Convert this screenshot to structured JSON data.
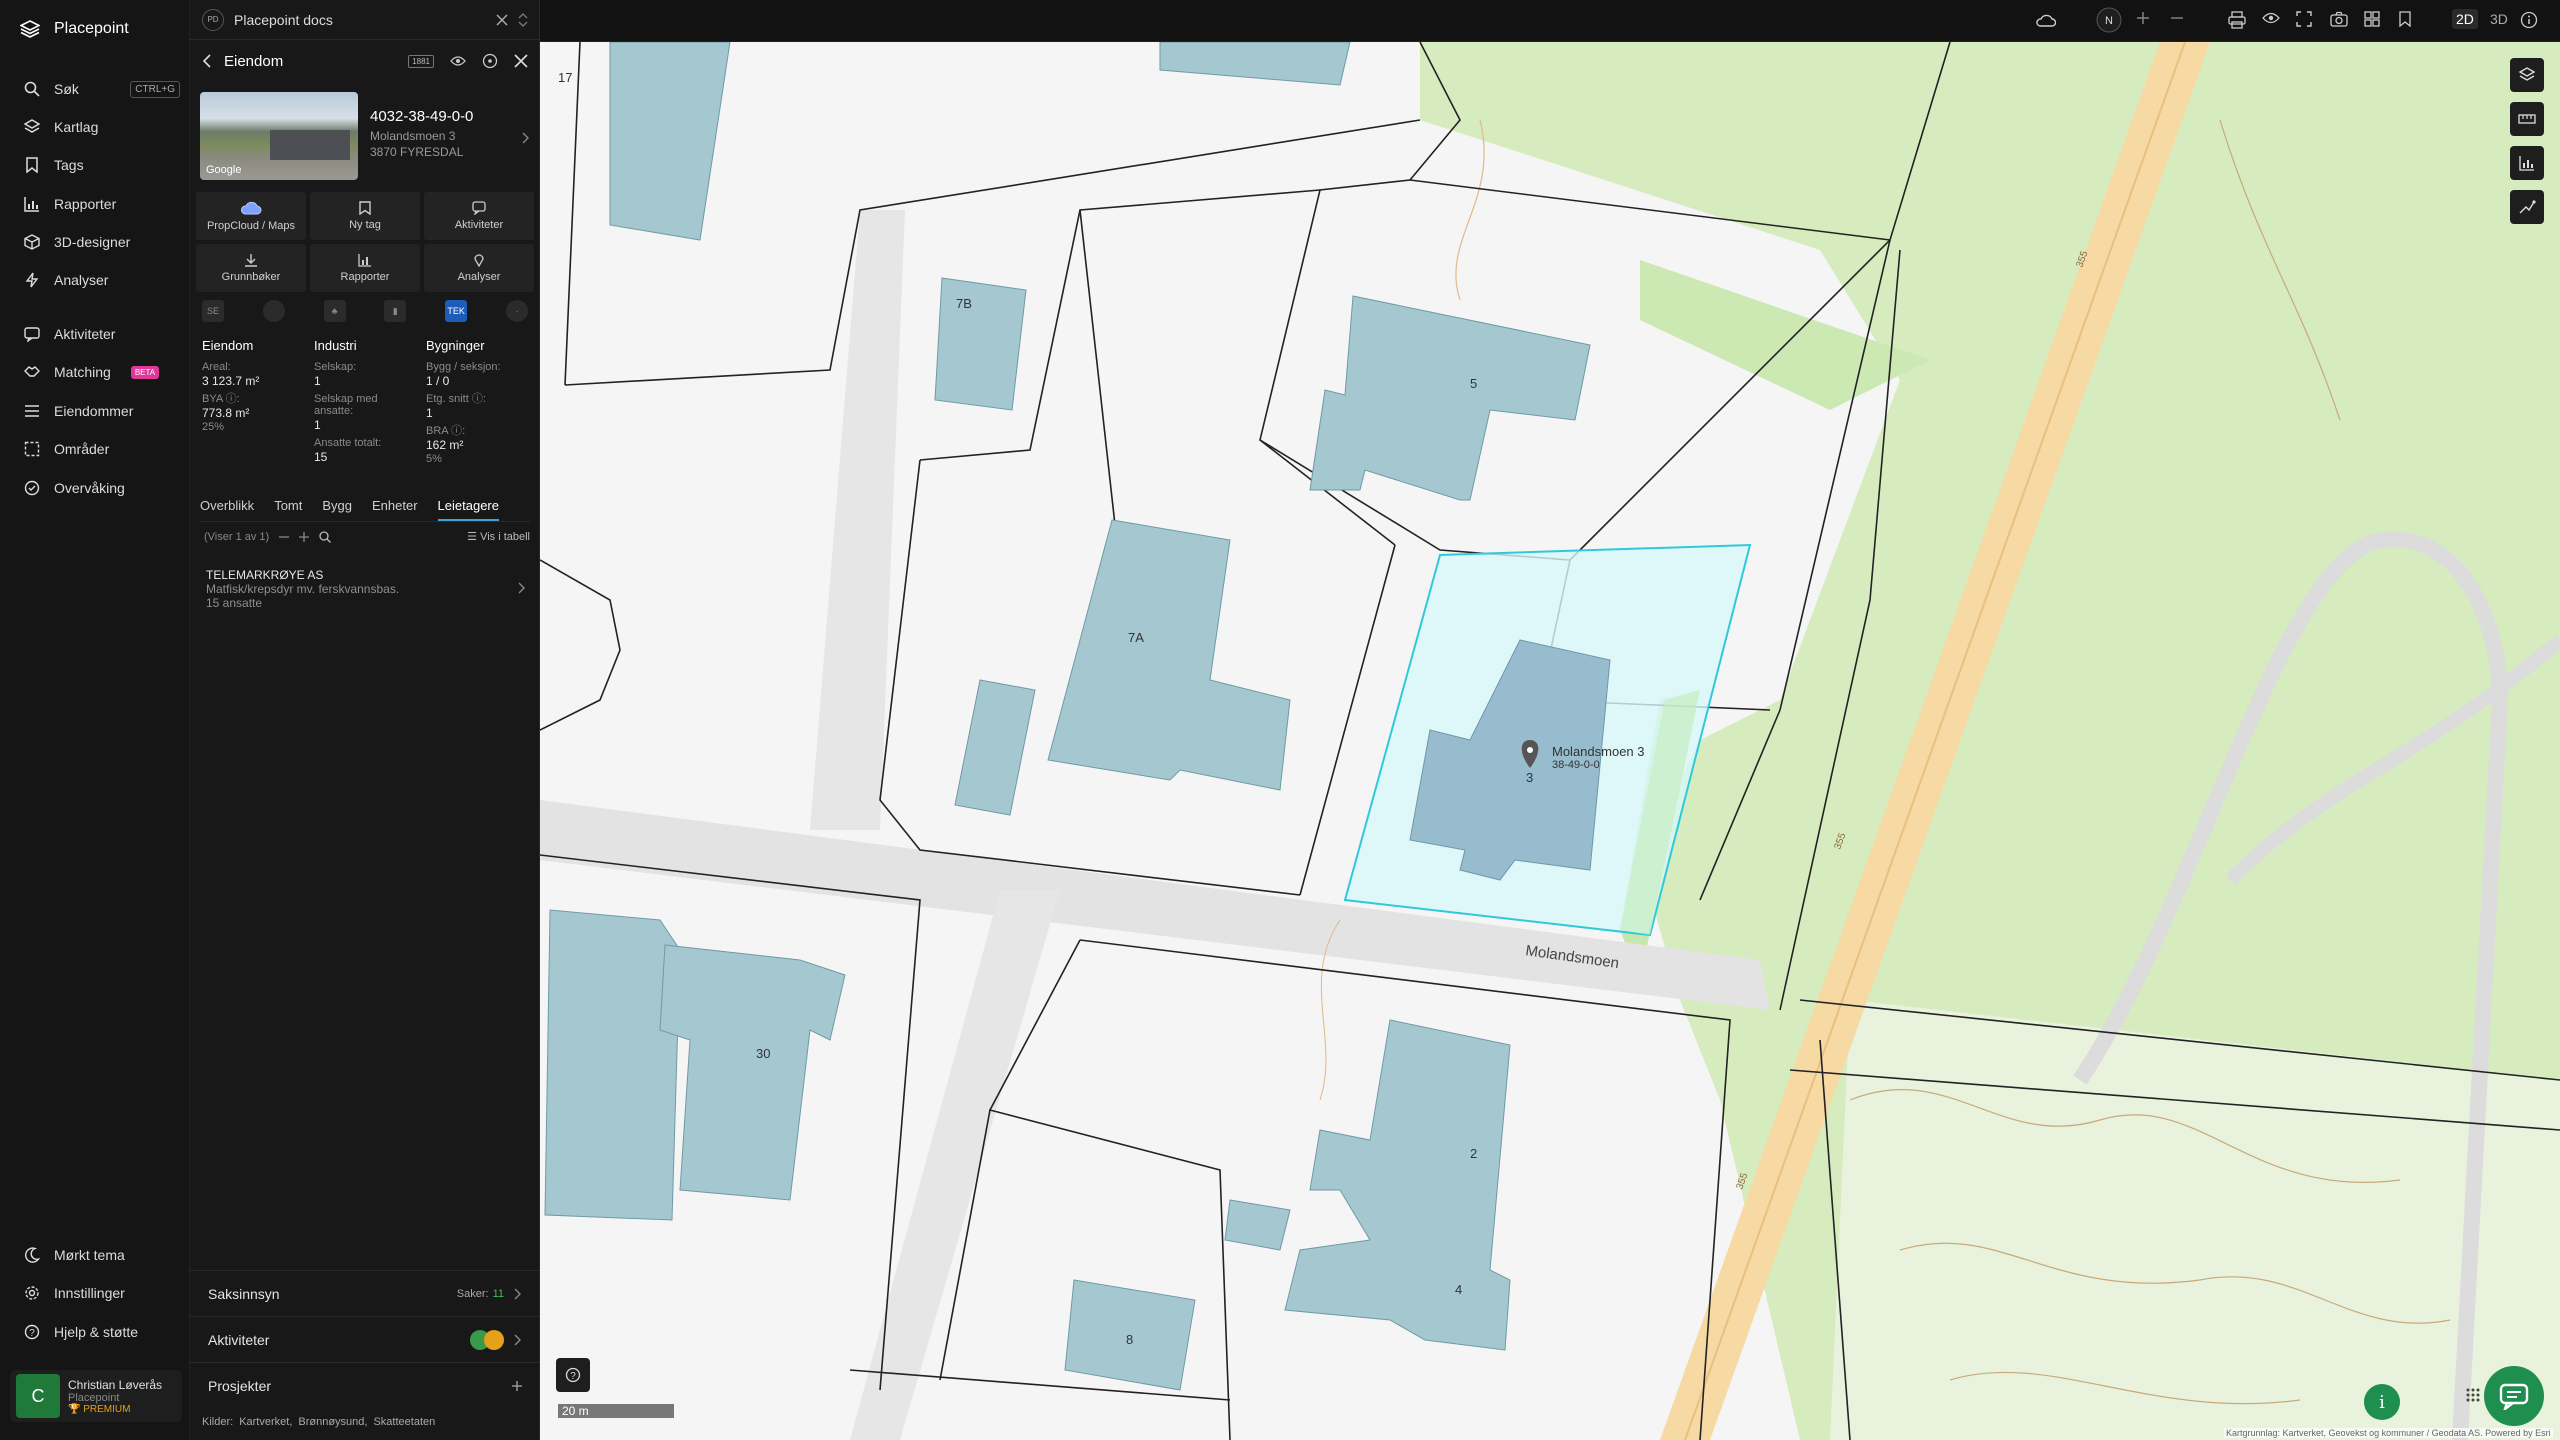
{
  "app": {
    "name": "Placepoint"
  },
  "nav": {
    "items": [
      {
        "label": "Søk",
        "shortcut": "CTRL+G"
      },
      {
        "label": "Kartlag"
      },
      {
        "label": "Tags"
      },
      {
        "label": "Rapporter"
      },
      {
        "label": "3D-designer"
      },
      {
        "label": "Analyser"
      },
      {
        "label": "Aktiviteter"
      },
      {
        "label": "Matching",
        "badge": "BETA"
      },
      {
        "label": "Eiendommer"
      },
      {
        "label": "Områder"
      },
      {
        "label": "Overvåking"
      }
    ],
    "bottom": [
      {
        "label": "Mørkt tema"
      },
      {
        "label": "Innstillinger"
      },
      {
        "label": "Hjelp & støtte"
      }
    ],
    "user": {
      "initial": "C",
      "name": "Christian Løverås",
      "org": "Placepoint",
      "plan": "PREMIUM"
    }
  },
  "docs": {
    "badge": "PD",
    "title": "Placepoint docs"
  },
  "panel": {
    "title": "Eiendom",
    "header_badge": "1881",
    "property": {
      "id": "4032-38-49-0-0",
      "address": "Molandsmoen 3",
      "postal": "3870 FYRESDAL",
      "photo_credit": "Google"
    },
    "actions": [
      {
        "label": "PropCloud / Maps"
      },
      {
        "label": "Ny tag"
      },
      {
        "label": "Aktiviteter"
      },
      {
        "label": "Grunnbøker"
      },
      {
        "label": "Rapporter"
      },
      {
        "label": "Analyser"
      }
    ],
    "source_icons": [
      "SE",
      "",
      "",
      "",
      "TEK",
      ""
    ],
    "stats": {
      "eiendom": {
        "title": "Eiendom",
        "areal_label": "Areal:",
        "areal_value": "3 123.7 m²",
        "bya_label": "BYA ⓘ:",
        "bya_value": "773.8 m²",
        "bya_pct": "25%"
      },
      "industri": {
        "title": "Industri",
        "selskap_label": "Selskap:",
        "selskap_value": "1",
        "ansatte_label": "Selskap med ansatte:",
        "ansatte_value": "1",
        "totalt_label": "Ansatte totalt:",
        "totalt_value": "15"
      },
      "bygninger": {
        "title": "Bygninger",
        "bygg_label": "Bygg / seksjon:",
        "bygg_value": "1 / 0",
        "etg_label": "Etg. snitt ⓘ:",
        "etg_value": "1",
        "bra_label": "BRA ⓘ:",
        "bra_value": "162 m²",
        "bra_pct": "5%"
      }
    },
    "tabs": [
      "Overblikk",
      "Tomt",
      "Bygg",
      "Enheter",
      "Leietagere"
    ],
    "active_tab": "Leietagere",
    "list": {
      "count_text": "(Viser 1 av 1)",
      "table_link": "Vis i tabell"
    },
    "tenant": {
      "name": "TELEMARKRØYE AS",
      "desc": "Matfisk/krepsdyr mv. ferskvannsbas.",
      "employees": "15 ansatte"
    },
    "sections": {
      "saksinnsyn": {
        "label": "Saksinnsyn",
        "count_label": "Saker:",
        "count": "11"
      },
      "aktiviteter": {
        "label": "Aktiviteter"
      },
      "prosjekter": {
        "label": "Prosjekter"
      }
    },
    "sources": {
      "label": "Kilder:",
      "items": [
        "Kartverket,",
        "Brønnøysund,",
        "Skatteetaten"
      ]
    }
  },
  "topbar": {
    "compass": "N",
    "mode_2d": "2D",
    "mode_3d": "3D",
    "active_mode": "2D"
  },
  "map": {
    "labels": {
      "selected_address": "Molandsmoen 3",
      "selected_id": "38-49-0-0",
      "street": "Molandsmoen",
      "road_number": "355",
      "plot_17": "17",
      "b7b": "7B",
      "b5": "5",
      "b7a": "7A",
      "b3": "3",
      "b30": "30",
      "b2": "2",
      "b4": "4",
      "b8": "8"
    },
    "scale": "20 m",
    "attribution": "Kartgrunnlag: Kartverket, Geovekst og kommuner / Geodata AS. Powered by Esri"
  }
}
